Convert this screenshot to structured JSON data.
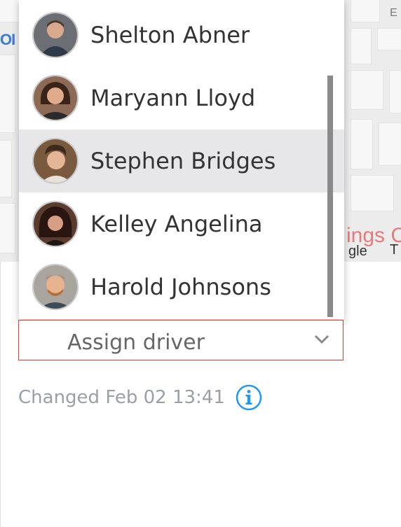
{
  "map": {
    "label_left": "OI",
    "label_e": "E",
    "label_red": "ings C",
    "label_gle": "gle",
    "label_t": "T"
  },
  "drivers": [
    {
      "name": "Shelton Abner",
      "selected": false
    },
    {
      "name": "Maryann Lloyd",
      "selected": false
    },
    {
      "name": "Stephen Bridges",
      "selected": true
    },
    {
      "name": "Kelley Angelina",
      "selected": false
    },
    {
      "name": "Harold Johnsons",
      "selected": false
    }
  ],
  "assign": {
    "placeholder": "Assign driver"
  },
  "status": {
    "changed_text": "Changed Feb 02 13:41"
  },
  "colors": {
    "accent": "#2196f3",
    "error_border": "#e53935",
    "selected_row": "#e7e7ea"
  },
  "icons": {
    "chevron": "chevron-down-icon",
    "info": "info-icon"
  }
}
